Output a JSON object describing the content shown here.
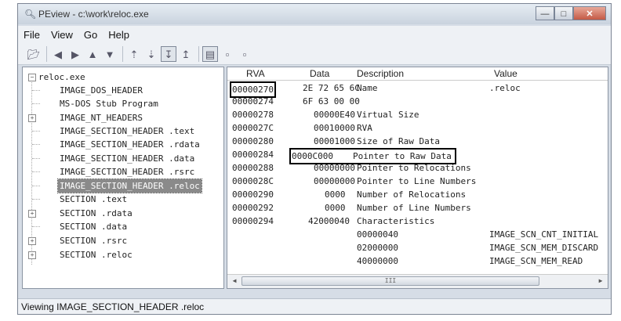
{
  "window": {
    "title": "PEview - c:\\work\\reloc.exe",
    "app_icon": "magnifier-icon",
    "buttons": [
      "minimize-icon",
      "maximize-icon",
      "close-icon"
    ]
  },
  "menu": [
    "File",
    "View",
    "Go",
    "Help"
  ],
  "toolbar": {
    "icons": [
      "open-icon",
      "back-icon",
      "forward-icon",
      "up-icon",
      "down-icon",
      "prev-icon",
      "next-icon",
      "view-a-icon",
      "view-b-icon",
      "view-hex-icon",
      "view-list-icon",
      "view-detail-icon"
    ]
  },
  "tree": {
    "items": [
      {
        "label": "reloc.exe",
        "expander": "-"
      },
      {
        "label": "IMAGE_DOS_HEADER"
      },
      {
        "label": "MS-DOS Stub Program"
      },
      {
        "label": "IMAGE_NT_HEADERS",
        "expander": "+"
      },
      {
        "label": "IMAGE_SECTION_HEADER .text"
      },
      {
        "label": "IMAGE_SECTION_HEADER .rdata"
      },
      {
        "label": "IMAGE_SECTION_HEADER .data"
      },
      {
        "label": "IMAGE_SECTION_HEADER .rsrc"
      },
      {
        "label": "IMAGE_SECTION_HEADER .reloc",
        "selected": true
      },
      {
        "label": "SECTION .text"
      },
      {
        "label": "SECTION .rdata",
        "expander": "+"
      },
      {
        "label": "SECTION .data"
      },
      {
        "label": "SECTION .rsrc",
        "expander": "+"
      },
      {
        "label": "SECTION .reloc",
        "expander": "+"
      }
    ]
  },
  "table": {
    "columns": [
      "RVA",
      "Data",
      "Description",
      "Value"
    ],
    "rows": [
      {
        "rva": "00000270",
        "data": "2E 72 65 6C",
        "desc": "Name",
        "value": ".reloc"
      },
      {
        "rva": "00000274",
        "data": "6F 63 00 00",
        "desc": "",
        "value": ""
      },
      {
        "rva": "00000278",
        "data": "00000E40",
        "desc": "Virtual Size",
        "value": ""
      },
      {
        "rva": "0000027C",
        "data": "00010000",
        "desc": "RVA",
        "value": ""
      },
      {
        "rva": "00000280",
        "data": "00001000",
        "desc": "Size of Raw Data",
        "value": ""
      },
      {
        "rva": "00000284",
        "data": "0000C000",
        "desc": "Pointer to Raw Data",
        "value": ""
      },
      {
        "rva": "00000288",
        "data": "00000000",
        "desc": "Pointer to Relocations",
        "value": ""
      },
      {
        "rva": "0000028C",
        "data": "00000000",
        "desc": "Pointer to Line Numbers",
        "value": ""
      },
      {
        "rva": "00000290",
        "data": "0000",
        "desc": "Number of Relocations",
        "value": ""
      },
      {
        "rva": "00000292",
        "data": "0000",
        "desc": "Number of Line Numbers",
        "value": ""
      },
      {
        "rva": "00000294",
        "data": "42000040",
        "desc": "Characteristics",
        "value": ""
      },
      {
        "rva": "",
        "data": "",
        "desc": "00000040",
        "value": "IMAGE_SCN_CNT_INITIAL"
      },
      {
        "rva": "",
        "data": "",
        "desc": "02000000",
        "value": "IMAGE_SCN_MEM_DISCARD"
      },
      {
        "rva": "",
        "data": "",
        "desc": "40000000",
        "value": "IMAGE_SCN_MEM_READ"
      }
    ]
  },
  "scrollbar": {
    "grip": "III"
  },
  "status": "Viewing IMAGE_SECTION_HEADER .reloc"
}
